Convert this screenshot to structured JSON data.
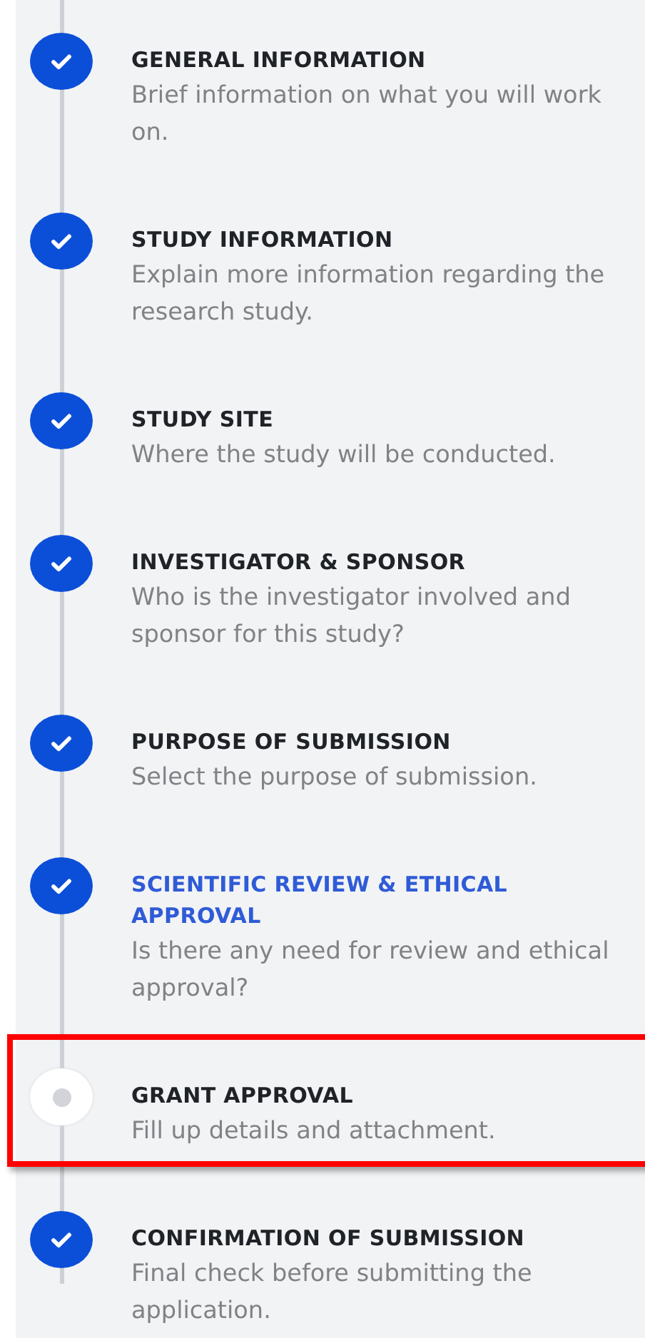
{
  "steps": [
    {
      "title": "GENERAL INFORMATION",
      "description": "Brief information on what you will work on.",
      "completed": true,
      "selected": false,
      "highlighted": false
    },
    {
      "title": "STUDY INFORMATION",
      "description": "Explain more information regarding the research study.",
      "completed": true,
      "selected": false,
      "highlighted": false
    },
    {
      "title": "STUDY SITE",
      "description": "Where the study will be conducted.",
      "completed": true,
      "selected": false,
      "highlighted": false
    },
    {
      "title": "INVESTIGATOR & SPONSOR",
      "description": "Who is the investigator involved and sponsor for this study?",
      "completed": true,
      "selected": false,
      "highlighted": false
    },
    {
      "title": "PURPOSE OF SUBMISSION",
      "description": "Select the purpose of submission.",
      "completed": true,
      "selected": false,
      "highlighted": false
    },
    {
      "title": "SCIENTIFIC REVIEW & ETHICAL APPROVAL",
      "description": "Is there any need for review and ethical approval?",
      "completed": true,
      "selected": true,
      "highlighted": false
    },
    {
      "title": "GRANT APPROVAL",
      "description": "Fill up details and attachment.",
      "completed": false,
      "selected": false,
      "highlighted": true
    },
    {
      "title": "CONFIRMATION OF SUBMISSION",
      "description": "Final check before submitting the application.",
      "completed": true,
      "selected": false,
      "highlighted": false
    }
  ]
}
